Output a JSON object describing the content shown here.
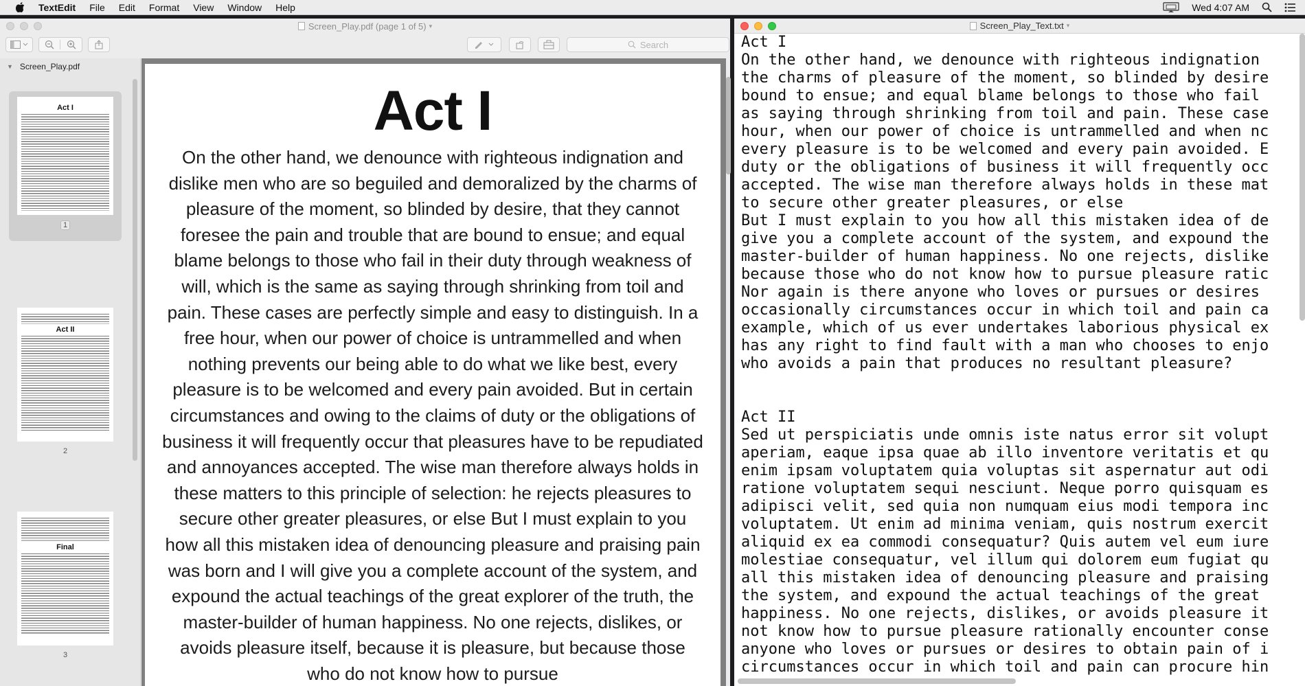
{
  "menubar": {
    "apple_icon": "apple-icon",
    "app_name": "TextEdit",
    "menus": [
      "File",
      "Edit",
      "Format",
      "View",
      "Window",
      "Help"
    ],
    "clock": "Wed 4:07 AM"
  },
  "preview": {
    "title": "Screen_Play.pdf (page 1 of 5)",
    "search_placeholder": "Search",
    "sidebar": {
      "filename": "Screen_Play.pdf",
      "thumbnails": [
        {
          "heading": "Act I",
          "page": "1",
          "selected": true
        },
        {
          "heading": "Act II",
          "page": "2",
          "selected": false
        },
        {
          "heading": "Final",
          "page": "3",
          "selected": false
        }
      ]
    },
    "page": {
      "heading": "Act I",
      "body": "On the other hand, we denounce with righteous indignation and dislike men who are so beguiled and demoralized by the charms of pleasure of the moment, so blinded by desire, that they cannot foresee the pain and trouble that are bound to ensue; and equal blame belongs to those who fail in their duty through weakness of will, which is the same as saying through shrinking from toil and pain. These cases are perfectly simple and easy to distinguish. In a free hour, when our power of choice is untrammelled and when nothing prevents our being able to do what we like best, every pleasure is to be welcomed and every pain avoided. But in certain circumstances and owing to the claims of duty or the obligations of business it will frequently occur that pleasures have to be repudiated and annoyances accepted. The wise man therefore always holds in these matters to this principle of selection: he rejects pleasures to secure other greater pleasures, or else But I must explain to you how all this mistaken idea of denouncing pleasure and praising pain was born and I will give you a complete account of the system, and expound the actual teachings of the great explorer of the truth, the master-builder of human happiness. No one rejects, dislikes, or avoids pleasure itself, because it is pleasure, but because those who do not know how to pursue"
    }
  },
  "textedit": {
    "title": "Screen_Play_Text.txt",
    "content": "Act I\nOn the other hand, we denounce with righteous indignation\nthe charms of pleasure of the moment, so blinded by desire\nbound to ensue; and equal blame belongs to those who fail\nas saying through shrinking from toil and pain. These case\nhour, when our power of choice is untrammelled and when nc\nevery pleasure is to be welcomed and every pain avoided. E\nduty or the obligations of business it will frequently occ\naccepted. The wise man therefore always holds in these mat\nto secure other greater pleasures, or else\nBut I must explain to you how all this mistaken idea of de\ngive you a complete account of the system, and expound the\nmaster-builder of human happiness. No one rejects, dislike\nbecause those who do not know how to pursue pleasure ratic\nNor again is there anyone who loves or pursues or desires\noccasionally circumstances occur in which toil and pain ca\nexample, which of us ever undertakes laborious physical ex\nhas any right to find fault with a man who chooses to enjo\nwho avoids a pain that produces no resultant pleasure?\n\n\nAct II\nSed ut perspiciatis unde omnis iste natus error sit volupt\naperiam, eaque ipsa quae ab illo inventore veritatis et qu\nenim ipsam voluptatem quia voluptas sit aspernatur aut odi\nratione voluptatem sequi nesciunt. Neque porro quisquam es\nadipisci velit, sed quia non numquam eius modi tempora inc\nvoluptatem. Ut enim ad minima veniam, quis nostrum exercit\naliquid ex ea commodi consequatur? Quis autem vel eum iure\nmolestiae consequatur, vel illum qui dolorem eum fugiat qu\nall this mistaken idea of denouncing pleasure and praising\nthe system, and expound the actual teachings of the great\nhappiness. No one rejects, dislikes, or avoids pleasure it\nnot know how to pursue pleasure rationally encounter conse\nanyone who loves or pursues or desires to obtain pain of i\ncircumstances occur in which toil and pain can procure hin"
  }
}
